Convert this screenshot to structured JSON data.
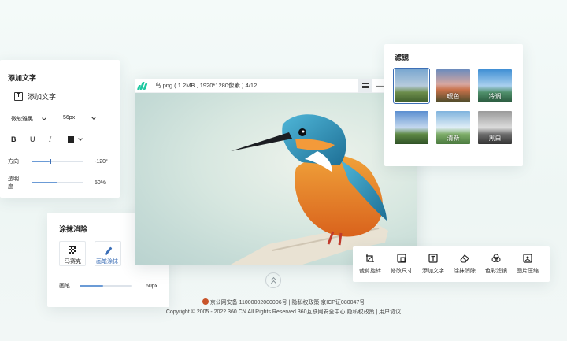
{
  "text_panel": {
    "title": "添加文字",
    "add_text_label": "添加文字",
    "font_family": "微软雅黑",
    "font_size": "56px",
    "bold": "B",
    "underline": "U",
    "italic": "I",
    "direction_label": "方向",
    "direction_value": "-120°",
    "direction_level": 0.35,
    "opacity_label": "透明度",
    "opacity_value": "50%",
    "opacity_level": 0.5
  },
  "erase_panel": {
    "title": "涂抹消除",
    "mosaic_label": "马赛克",
    "brush_label": "画笔涂抹",
    "pen_label": "画笔",
    "pen_value": "60px",
    "pen_level": 0.45
  },
  "viewer": {
    "file_info": "鸟.png ( 1.2MB , 1920*1280像素 ) 4/12"
  },
  "filter_panel": {
    "title": "滤镜",
    "items": [
      {
        "label": "",
        "selected": true
      },
      {
        "label": "暖色",
        "selected": false
      },
      {
        "label": "冷调",
        "selected": false
      },
      {
        "label": "",
        "selected": false
      },
      {
        "label": "清新",
        "selected": false
      },
      {
        "label": "黑白",
        "selected": false
      }
    ]
  },
  "toolbar": {
    "items": [
      {
        "label": "裁剪旋转",
        "icon": "crop-rotate-icon"
      },
      {
        "label": "修改尺寸",
        "icon": "resize-icon"
      },
      {
        "label": "添加文字",
        "icon": "add-text-icon"
      },
      {
        "label": "涂抹消除",
        "icon": "eraser-icon"
      },
      {
        "label": "色彩滤镜",
        "icon": "color-filter-icon"
      },
      {
        "label": "图片压缩",
        "icon": "image-compress-icon"
      }
    ]
  },
  "footer": {
    "line1": "京公网安备 11000002000006号 | 隐私权政策 京ICP证080047号",
    "line2": "Copyright © 2005 - 2022 360.CN All Rights Reserved 360互联网安全中心 隐私权政策 | 用户协议"
  },
  "colors": {
    "accent": "#3d6fb6",
    "brand": "#1cc8a0"
  }
}
